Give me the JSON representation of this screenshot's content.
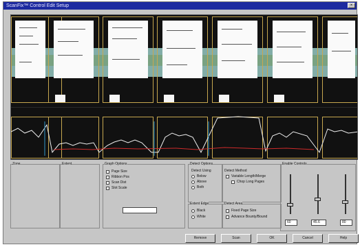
{
  "window": {
    "title": "ScanFix™ Control Edit Setup"
  },
  "viewer": {
    "page_count": 7
  },
  "panels": {
    "zone": "Zone",
    "extent": "Extent",
    "graph_options": "Graph Options",
    "detect_options": "Detect Options",
    "detect_using": "Detect Using",
    "detect_method": "Detect Method",
    "extent_edge": "Extent Edge",
    "detect_area": "Detect Area",
    "enable_controls": "Enable Controls"
  },
  "graph_options": [
    "Page Size",
    "Ribbon Pos",
    "Scan Dist",
    "Slot Scale"
  ],
  "detect_using": [
    "Below",
    "Above",
    "Both"
  ],
  "extent_edge": [
    "Black",
    "White"
  ],
  "detect_method": [
    "Variable Length/Merge",
    "Chop Long Pages"
  ],
  "detect_area": [
    "Fixed Page Size",
    "Advance Bounty/Bound"
  ],
  "fields": {
    "left": "60",
    "mid": "45.6",
    "right": "80"
  },
  "buttons": [
    "Remove",
    "Scan",
    "OK",
    "Cancel",
    "Help"
  ]
}
